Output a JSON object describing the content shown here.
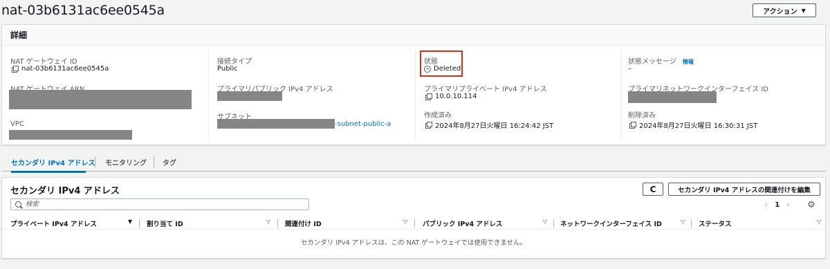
{
  "header": {
    "title": "nat-03b6131ac6ee0545a",
    "actions_label": "アクション"
  },
  "details": {
    "heading": "詳細",
    "nat_id_label": "NAT ゲートウェイ ID",
    "nat_id_value": "nat-03b6131ac6ee0545a",
    "nat_arn_label": "NAT ゲートウェイ ARN",
    "vpc_label": "VPC",
    "connection_type_label": "接続タイプ",
    "connection_type_value": "Public",
    "primary_public_ip_label": "プライマリパブリック IPv4 アドレス",
    "subnet_label": "サブネット",
    "subnet_suffix": "-subnet-public-a",
    "state_label": "状態",
    "state_value": "Deleted",
    "primary_private_ip_label": "プライマリプライベート IPv4 アドレス",
    "primary_private_ip_value": "10.0.10.114",
    "created_label": "作成済み",
    "created_value": "2024年8月27日火曜日 16:24:42 JST",
    "state_message_label": "状態メッセージ",
    "info_link": "情報",
    "state_message_value": "–",
    "primary_eni_label": "プライマリネットワークインターフェイス ID",
    "deleted_label": "削除済み",
    "deleted_value": "2024年8月27日火曜日 16:30:31 JST"
  },
  "tabs": [
    {
      "label": "セカンダリ IPv4 アドレス",
      "active": true
    },
    {
      "label": "モニタリング",
      "active": false
    },
    {
      "label": "タグ",
      "active": false
    }
  ],
  "secondary": {
    "title": "セカンダリ IPv4 アドレス",
    "refresh_glyph": "C",
    "edit_button": "セカンダリ IPv4 アドレスの関連付けを編集",
    "search_placeholder": "検索",
    "page": "1",
    "columns": [
      "プライベート IPv4 アドレス",
      "割り当て ID",
      "関連付け ID",
      "パブリック IPv4 アドレス",
      "ネットワークインターフェイス ID",
      "ステータス"
    ],
    "empty_message": "セカンダリ IPv4 アドレスは、この NAT ゲートウェイでは使用できません。"
  },
  "icons": {
    "copy": "copy-icon",
    "status": "minus-circle-icon",
    "search": "search-icon",
    "refresh": "refresh-icon",
    "settings": "gear-icon"
  },
  "colors": {
    "link": "#0073bb",
    "highlight_border": "#d13212",
    "redaction": "#858585"
  }
}
